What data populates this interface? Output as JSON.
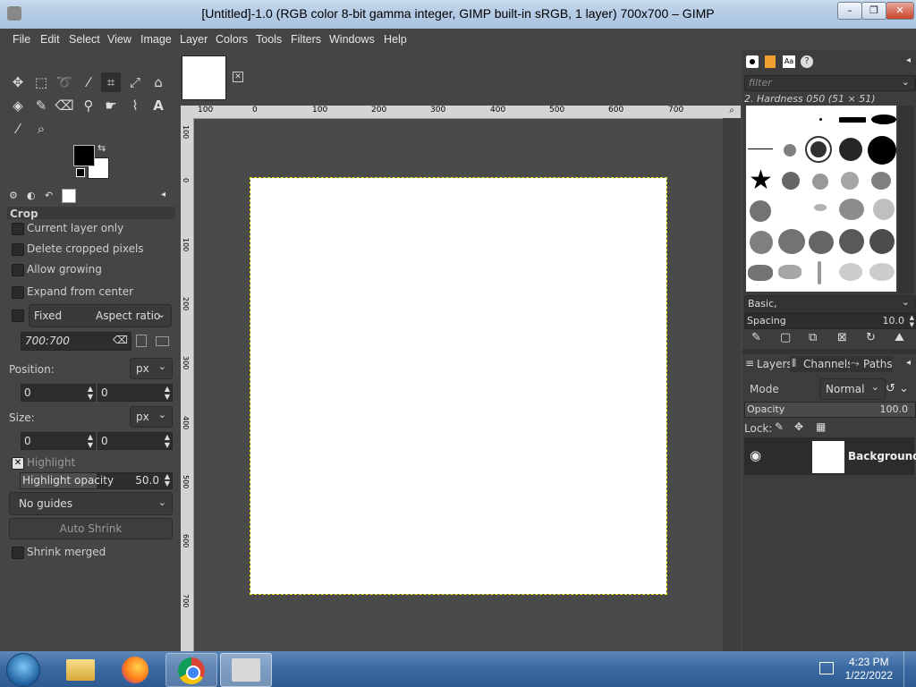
{
  "window": {
    "title": "[Untitled]-1.0 (RGB color 8-bit gamma integer, GIMP built-in sRGB, 1 layer) 700x700 – GIMP"
  },
  "menubar": [
    "File",
    "Edit",
    "Select",
    "View",
    "Image",
    "Layer",
    "Colors",
    "Tools",
    "Filters",
    "Windows",
    "Help"
  ],
  "tool_options": {
    "title": "Crop",
    "current_layer_only": "Current layer only",
    "delete_cropped": "Delete cropped pixels",
    "allow_growing": "Allow growing",
    "expand_from_center": "Expand from center",
    "fixed": "Fixed",
    "aspect_ratio": "Aspect ratio",
    "ratio_value": "700:700",
    "position_label": "Position:",
    "position_unit": "px",
    "position_x": "0",
    "position_y": "0",
    "size_label": "Size:",
    "size_unit": "px",
    "size_w": "0",
    "size_h": "0",
    "highlight": "Highlight",
    "highlight_opacity_label": "Highlight opacity",
    "highlight_opacity_value": "50.0",
    "guides": "No guides",
    "auto_shrink": "Auto Shrink",
    "shrink_merged": "Shrink merged"
  },
  "rulers": {
    "horizontal": [
      "100",
      "0",
      "100",
      "200",
      "300",
      "400",
      "500",
      "600",
      "700"
    ],
    "vertical": [
      "100",
      "0",
      "100",
      "200",
      "300",
      "400",
      "500",
      "600",
      "700"
    ]
  },
  "brushes": {
    "filter_placeholder": "filter",
    "selected_brush": "2. Hardness 050 (51 × 51)",
    "tag": "Basic,",
    "spacing_label": "Spacing",
    "spacing_value": "10.0"
  },
  "layers": {
    "tabs": [
      "Layers",
      "Channels",
      "Paths"
    ],
    "mode_label": "Mode",
    "mode_value": "Normal",
    "opacity_label": "Opacity",
    "opacity_value": "100.0",
    "lock_label": "Lock:",
    "layer_name": "Background"
  },
  "taskbar": {
    "time": "4:23 PM",
    "date": "1/22/2022"
  },
  "colors": {
    "accent": "#e5e51a",
    "dark_bg": "#454545"
  }
}
